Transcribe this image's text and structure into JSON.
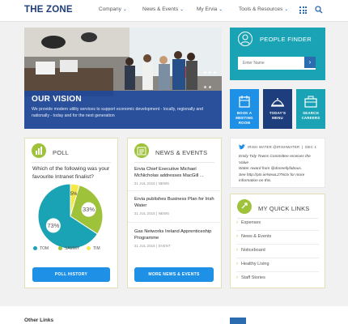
{
  "header": {
    "logo": "THE ZONE",
    "nav": [
      "Company",
      "News & Events",
      "My Ervia",
      "Tools & Resources"
    ]
  },
  "hero": {
    "title": "OUR VISION",
    "text": "We provide modern utility services to support economic development - locally, regionally and nationally - today and for the next generation"
  },
  "people_finder": {
    "title": "PEOPLE FINDER",
    "placeholder": "Enter Name"
  },
  "tiles": [
    {
      "label_1": "BOOK A",
      "label_2": "MEETING",
      "label_3": "ROOM",
      "color": "#1e90e6"
    },
    {
      "label_1": "TODAY'S",
      "label_2": "MENU",
      "label_3": "",
      "color": "#1d3d7c"
    },
    {
      "label_1": "SEARCH",
      "label_2": "CAREERS",
      "label_3": "",
      "color": "#1aa3b5"
    }
  ],
  "poll": {
    "title": "POLL",
    "question": "Which of the following was your favourite Intranet finalist?",
    "button": "POLL HISTORY"
  },
  "chart_data": {
    "type": "pie",
    "categories": [
      "TOM",
      "SAMMY",
      "TIM"
    ],
    "values": [
      73,
      33,
      5
    ],
    "data_labels": [
      "73%",
      "33%",
      "5%"
    ],
    "colors": [
      "#1aa3b5",
      "#9ec23a",
      "#f5e84b"
    ],
    "legend_position": "bottom"
  },
  "news": {
    "title": "NEWS & EVENTS",
    "items": [
      {
        "title": "Ervia Chief Executive Michael McNicholas addresses MacGill ...",
        "date": "21 JUL 2015",
        "type": "NEWS"
      },
      {
        "title": "Ervia publishes Business Plan for Irish Water",
        "date": "21 JUL 2015",
        "type": "NEWS"
      },
      {
        "title": "Gas Networks Ireland Apprenticeship Programme",
        "date": "21 JUL 2015",
        "type": "EVENT"
      }
    ],
    "button": "MORE NEWS & EVENTS"
  },
  "twitter": {
    "handle": "IRISH WATER @IRISHWATER",
    "date": "DEC 1",
    "line_1": "Emily Tidy Towns Committee receives the Value",
    "line_2": "Water Award from @donnellyfabous.",
    "line_3": "See http://ptn.ie/NewL27Nctv for more",
    "line_4": "information on this."
  },
  "quick_links": {
    "title": "MY QUICK LINKS",
    "items": [
      "Expenses",
      "News & Events",
      "Noticeboard",
      "Healthy Living",
      "Staff Stories"
    ]
  },
  "footer": {
    "label": "Other Links"
  }
}
